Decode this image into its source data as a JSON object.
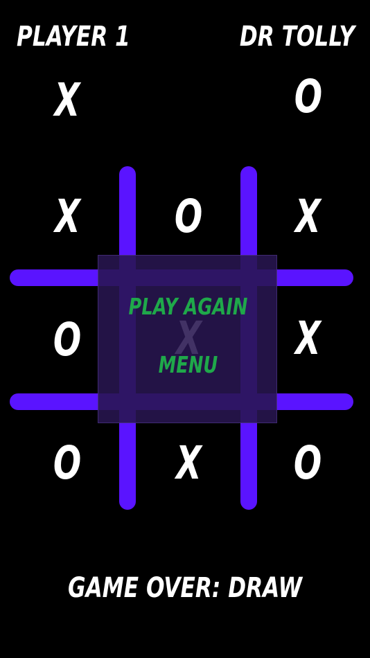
{
  "players": {
    "player1": {
      "name": "PLAYER 1",
      "symbol": "X"
    },
    "player2": {
      "name": "DR TOLLY",
      "symbol": "O"
    }
  },
  "board": {
    "cells": [
      "X",
      "O",
      "X",
      "O",
      "X",
      "X",
      "O",
      "X",
      "O"
    ]
  },
  "menu": {
    "play_again_label": "PLAY AGAIN",
    "menu_label": "MENU"
  },
  "status": {
    "text": "GAME OVER: DRAW"
  },
  "colors": {
    "background": "#000000",
    "grid": "#5a14ff",
    "menu_text": "#1fa84a",
    "marks": "#ffffff"
  }
}
